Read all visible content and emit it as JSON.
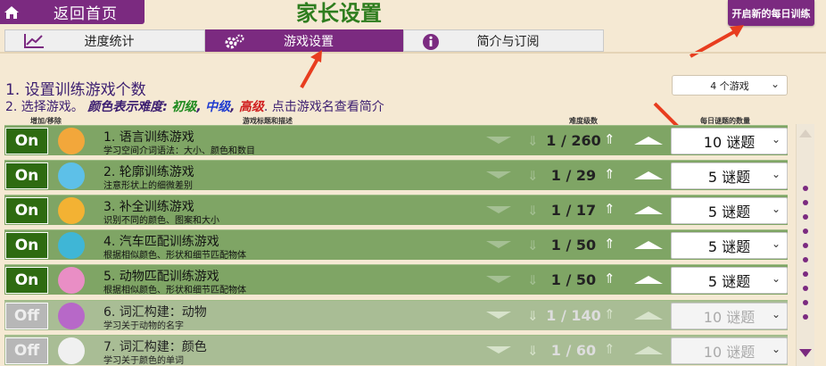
{
  "header": {
    "home_label": "返回首页",
    "title": "家长设置",
    "daily_button": "开启新的每日训练"
  },
  "tabs": [
    {
      "label": "进度统计",
      "icon": "chart-icon",
      "active": false
    },
    {
      "label": "游戏设置",
      "icon": "gears-icon",
      "active": true
    },
    {
      "label": "简介与订阅",
      "icon": "info-icon",
      "active": false
    }
  ],
  "section": {
    "line1": "1. 设置训练游戏个数",
    "line2_prefix": "2. 选择游戏。",
    "line2_colors_label": "颜色表示难度:",
    "easy": "初级",
    "mid": "中级",
    "hard": "高级",
    "line2_suffix": ". 点击游戏名查看简介",
    "games_select": "4 个游戏"
  },
  "columns": {
    "add_remove": "增加/移除",
    "title_desc": "游戏标题和描述",
    "difficulty": "难度级数",
    "daily_count": "每日谜题的数量"
  },
  "colors": {
    "purple": "#7b2a80",
    "on_green": "#2e6b11",
    "row_green": "#7fa565",
    "title_green": "#2e7d1e"
  },
  "games": [
    {
      "toggle": "On",
      "title": "1. 语言训练游戏",
      "desc": "学习空间介词语法：大小、颜色和数目",
      "level": "1 / 260",
      "puzzles": "10 谜题",
      "icon": "book-icon"
    },
    {
      "toggle": "On",
      "title": "2. 轮廓训练游戏",
      "desc": "注意形状上的细微差别",
      "level": "1 / 29",
      "puzzles": "5 谜题",
      "icon": "figure-icon"
    },
    {
      "toggle": "On",
      "title": "3. 补全训练游戏",
      "desc": "识别不同的颜色、图案和大小",
      "level": "1 / 17",
      "puzzles": "5 谜题",
      "icon": "puzzle-icon"
    },
    {
      "toggle": "On",
      "title": "4. 汽车匹配训练游戏",
      "desc": "根据相似颜色、形状和细节匹配物体",
      "level": "1 / 50",
      "puzzles": "5 谜题",
      "icon": "car-icon"
    },
    {
      "toggle": "On",
      "title": "5. 动物匹配训练游戏",
      "desc": "根据相似颜色、形状和细节匹配物体",
      "level": "1 / 50",
      "puzzles": "5 谜题",
      "icon": "pig-icon"
    },
    {
      "toggle": "Off",
      "title": "6. 词汇构建：动物",
      "desc": "学习关于动物的名字",
      "level": "1 / 140",
      "puzzles": "10 谜题",
      "icon": "animal-icon"
    },
    {
      "toggle": "Off",
      "title": "7. 词汇构建：颜色",
      "desc": "学习关于颜色的单词",
      "level": "1 / 60",
      "puzzles": "10 谜题",
      "icon": "colors-icon"
    }
  ]
}
